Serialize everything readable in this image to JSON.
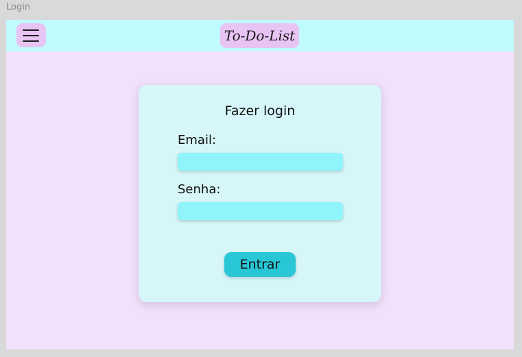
{
  "frame": {
    "label": "Login"
  },
  "header": {
    "menu_icon": "hamburger-menu-icon",
    "logo_text": "To-Do-List"
  },
  "login_card": {
    "title": "Fazer login",
    "email_label": "Email:",
    "email_value": "",
    "password_label": "Senha:",
    "password_value": "",
    "submit_label": "Entrar"
  },
  "colors": {
    "canvas_background": "#d9d9d9",
    "page_background": "#f2e1fa",
    "header_background": "#c0fafd",
    "accent_pink": "#e8c4f4",
    "card_background": "#d6f6f9",
    "input_background": "#8ff5fa",
    "button_background": "#29c7d6"
  }
}
